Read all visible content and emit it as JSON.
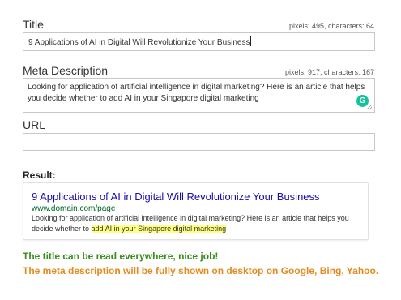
{
  "title_field": {
    "label": "Title",
    "pixels_label": "pixels: 495, characters: 64",
    "value": "9 Applications of AI in Digital Will Revolutionize Your Business"
  },
  "meta_field": {
    "label": "Meta Description",
    "pixels_label": "pixels: 917, characters: 167",
    "value": "Looking for application of artificial intelligence in digital marketing? Here is an article that helps you decide whether to add AI in your Singapore digital marketing",
    "grammarly_icon_text": "G"
  },
  "url_field": {
    "label": "URL",
    "value": ""
  },
  "result": {
    "label": "Result:",
    "serp_title": "9 Applications of AI in Digital Will Revolutionize Your Business",
    "serp_url": "www.domain.com/page",
    "serp_desc_plain": "Looking for application of artificial intelligence in digital marketing? Here is an article that helps you decide whether to ",
    "serp_desc_highlight": "add AI in your Singapore digital marketing"
  },
  "status": {
    "title_message": "The title can be read everywhere, nice job!",
    "meta_message": "The meta description will be fully shown on desktop on Google, Bing, Yahoo."
  },
  "colors": {
    "good": "#3a8c1e",
    "warn": "#e58a1f",
    "serp_link": "#1a0dab",
    "serp_url": "#006621",
    "highlight": "#ffff80",
    "grammarly": "#15c39a"
  },
  "icons": {
    "grammarly": "grammarly-icon",
    "resize": "resize-grip-icon"
  }
}
